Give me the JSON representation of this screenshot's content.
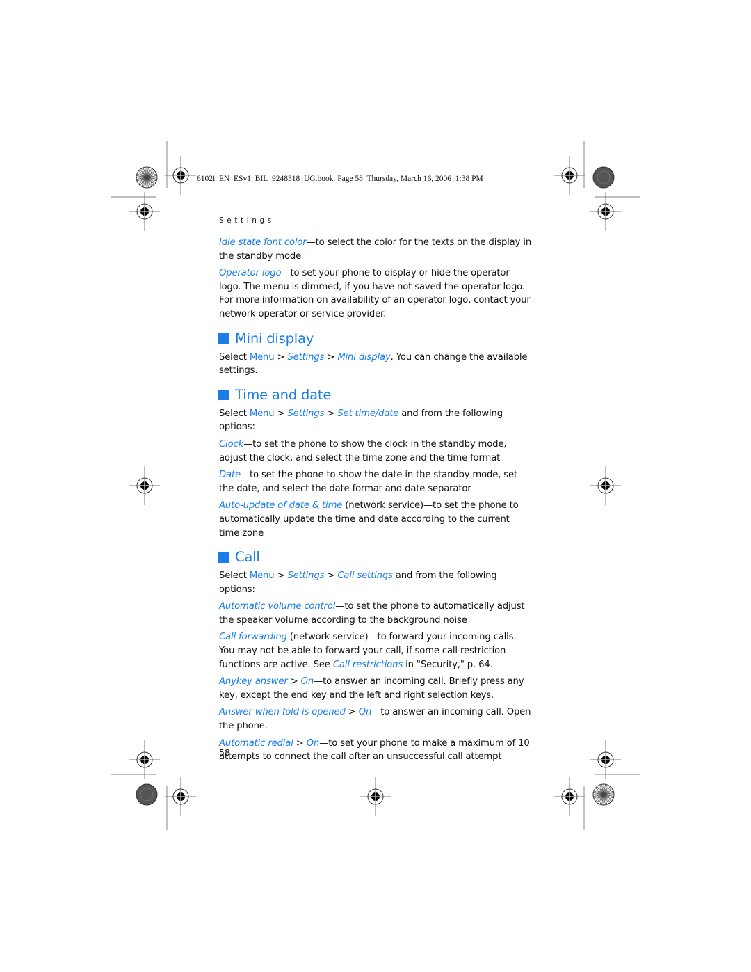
{
  "book_header": "6102i_EN_ESv1_BIL_9248318_UG.book  Page 58  Thursday, March 16, 2006  1:38 PM",
  "section_label": "Settings",
  "colors": {
    "accent": "#1a7de8",
    "text": "#111111"
  },
  "intro_items": [
    {
      "term": "Idle state font color",
      "desc": "—to select the color for the texts on the display in the standby mode"
    },
    {
      "term": "Operator logo",
      "desc": "—to set your phone to display or hide the operator logo. The menu is dimmed, if you have not saved the operator logo. For more information on availability of an operator logo, contact your network operator or service provider."
    }
  ],
  "sections": {
    "mini_display": {
      "title": "Mini display",
      "select": "Select",
      "menu": "Menu",
      "sep": " > ",
      "path1": "Settings",
      "path2": "Mini display",
      "tail": ". You can change the available settings."
    },
    "time_date": {
      "title": "Time and date",
      "select": "Select",
      "menu": "Menu",
      "sep": " > ",
      "path1": "Settings",
      "path2": "Set time/date",
      "tail": " and from the following options:",
      "items": [
        {
          "term": "Clock",
          "desc": "—to set the phone to show the clock in the standby mode, adjust the clock, and select the time zone and the time format"
        },
        {
          "term": "Date",
          "desc": "—to set the phone to show the date in the standby mode, set the date, and select the date format and date separator"
        },
        {
          "term": "Auto-update of date & time",
          "desc": " (network service)—to set the phone to automatically update the time and date according to the current time zone"
        }
      ]
    },
    "call": {
      "title": "Call",
      "select": "Select",
      "menu": "Menu",
      "sep": " > ",
      "path1": "Settings",
      "path2": "Call settings",
      "tail": " and from the following options:",
      "items": [
        {
          "term": "Automatic volume control",
          "desc": "—to set the phone to automatically adjust the speaker volume according to the background noise"
        },
        {
          "term": "Call forwarding",
          "desc": " (network service)—to forward your incoming calls. You may not be able to forward your call, if some call restriction functions are active. See ",
          "link": "Call restrictions",
          "desc2": " in \"Security,\" p. 64."
        },
        {
          "term": "Anykey answer",
          "sep": " > ",
          "option": "On",
          "desc": "—to answer an incoming call. Briefly press any key, except the end key and the left and right selection keys."
        },
        {
          "term": "Answer when fold is opened",
          "sep": " > ",
          "option": "On",
          "desc": "—to answer an incoming call. Open the phone."
        },
        {
          "term": "Automatic redial",
          "sep": " > ",
          "option": "On",
          "desc": "—to set your phone to make a maximum of 10 attempts to connect the call after an unsuccessful call attempt"
        }
      ]
    }
  },
  "page_number": "58"
}
